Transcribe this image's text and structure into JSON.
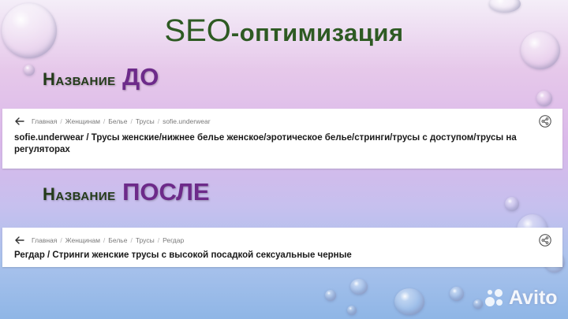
{
  "slide": {
    "title_seo": "SEO",
    "title_rest": "-оптимизация"
  },
  "before": {
    "label": "Название",
    "emphasis": "ДО",
    "breadcrumbs": [
      "Главная",
      "Женщинам",
      "Белье",
      "Трусы",
      "sofie.underwear"
    ],
    "product_title": "sofie.underwear / Трусы женские/нижнее белье женское/эротическое белье/стринги/трусы с доступом/трусы на регуляторах"
  },
  "after": {
    "label": "Название",
    "emphasis": "ПОСЛЕ",
    "breadcrumbs": [
      "Главная",
      "Женщинам",
      "Белье",
      "Трусы",
      "Регдар"
    ],
    "product_title": "Регдар / Стринги женские трусы с высокой посадкой сексуальные черные"
  },
  "watermark": {
    "text": "Avito"
  },
  "icons": {
    "back": "arrow-left-icon",
    "share": "share-icon",
    "watermark": "avito-logo-icon"
  },
  "colors": {
    "title_green": "#2e5a23",
    "emphasis_purple": "#6d2a8a",
    "heading_dark": "#243b1a"
  }
}
